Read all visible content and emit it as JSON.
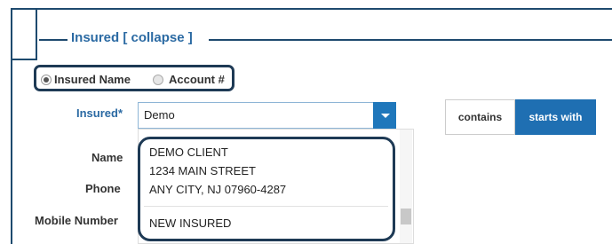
{
  "section": {
    "legend": "Insured [ collapse ]"
  },
  "search_by": {
    "options": [
      {
        "label": "Insured Name",
        "selected": true
      },
      {
        "label": "Account #",
        "selected": false
      }
    ]
  },
  "form": {
    "insured_label": "Insured*",
    "insured_value": "Demo",
    "name_label": "Name",
    "phone_label": "Phone",
    "mobile_label": "Mobile Number"
  },
  "match_mode": {
    "contains_label": "contains",
    "starts_with_label": "starts with",
    "active": "starts with"
  },
  "suggestions": {
    "items": [
      {
        "line1": "DEMO CLIENT",
        "line2": "1234 MAIN STREET",
        "line3": "ANY CITY, NJ 07960-4287"
      },
      {
        "line1": "NEW INSURED"
      }
    ]
  },
  "colors": {
    "accent": "#1f77bb",
    "frame": "#1e4a6e",
    "legend_text": "#2b6aa3",
    "highlight_border": "#1e3a55"
  }
}
